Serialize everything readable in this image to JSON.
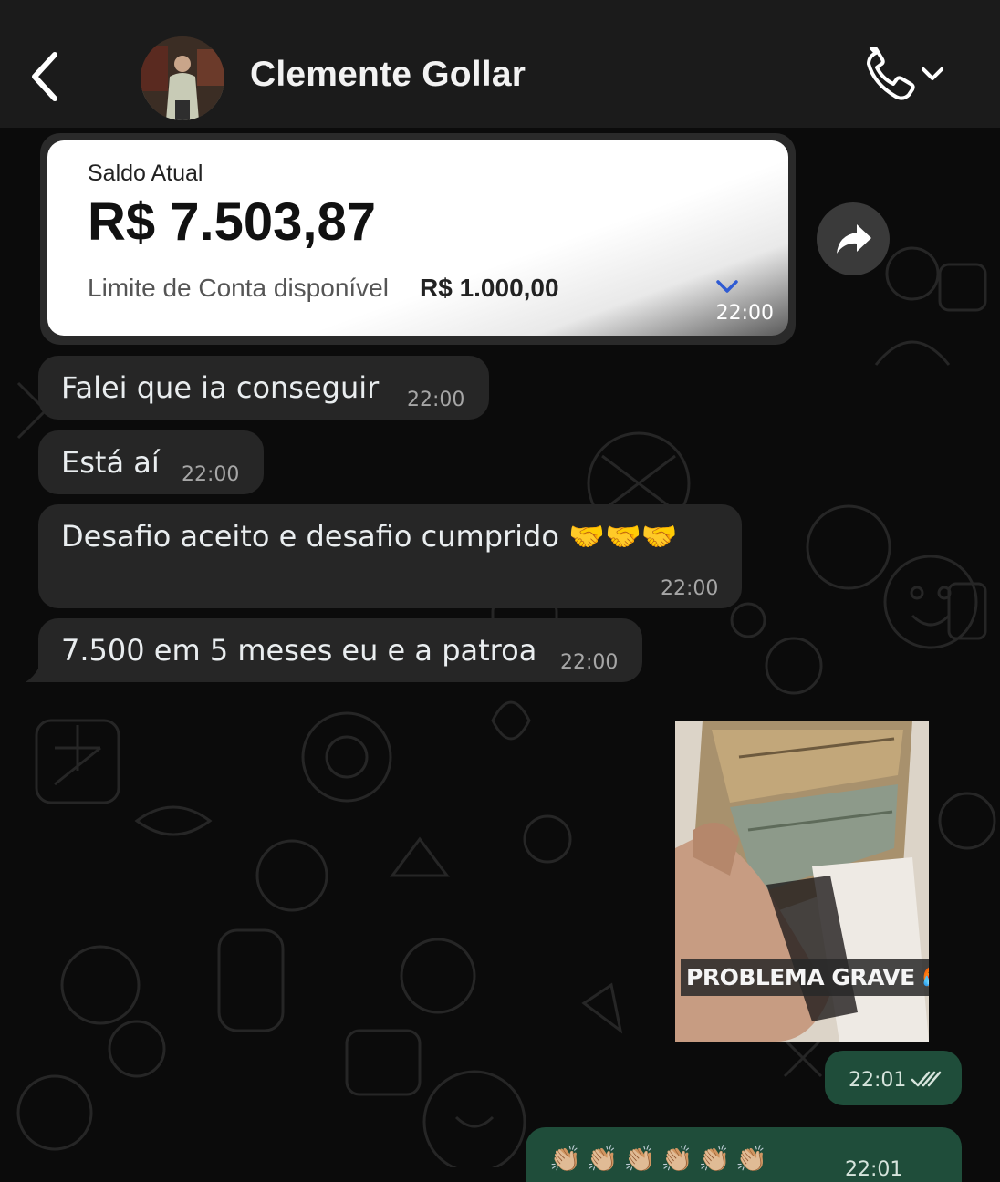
{
  "header": {
    "contact_name": "Clemente Gollar"
  },
  "balance_card": {
    "label": "Saldo Atual",
    "amount": "R$ 7.503,87",
    "limit_label": "Limite de Conta disponível",
    "limit_value": "R$ 1.000,00",
    "time": "22:00"
  },
  "messages": [
    {
      "text": "Falei que ia conseguir",
      "time": "22:00"
    },
    {
      "text": "Está aí",
      "time": "22:00"
    },
    {
      "text": "Desafio aceito e desafio cumprido 🤝🤝🤝",
      "time": "22:00"
    },
    {
      "text": "7.500 em 5 meses eu e a patroa",
      "time": "22:00"
    }
  ],
  "outgoing": {
    "image_caption": "PROBLEMA GRAVE 🥵🥵",
    "image_time": "22:01",
    "partial_emojis": "👏🏼👏🏼👏🏼👏🏼👏🏼👏🏼",
    "partial_time": "22:01"
  },
  "colors": {
    "header_bg": "#1b1b1b",
    "chat_bg": "#0b0b0b",
    "incoming_bubble": "#262626",
    "outgoing_bubble": "#1f4d3a",
    "accent_blue": "#2f5bd3"
  },
  "icons": [
    "back-chevron-icon",
    "phone-icon",
    "chevron-down-icon",
    "forward-icon",
    "double-check-icon"
  ]
}
